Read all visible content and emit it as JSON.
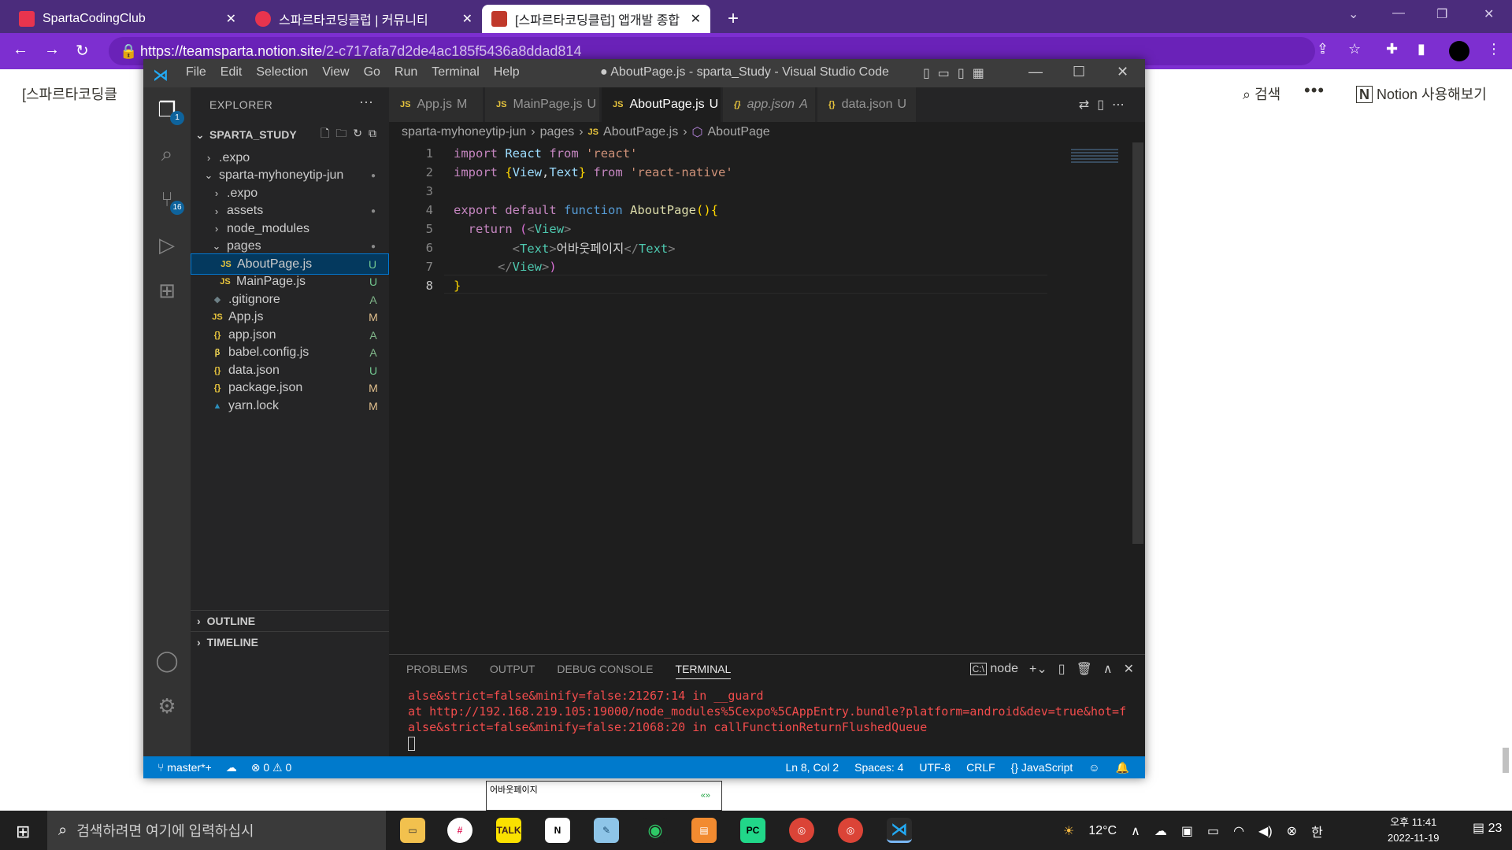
{
  "browser": {
    "tabs": [
      {
        "label": "SpartaCodingClub",
        "active": false
      },
      {
        "label": "스파르타코딩클럽 | 커뮤니티",
        "active": false
      },
      {
        "label": "[스파르타코딩클럽] 앱개발 종합",
        "active": true
      }
    ],
    "new_tab": "+",
    "url_host": "https://teamsparta.notion.site",
    "url_path": "/2-c717afa7d2de4ac185f5436a8ddad814"
  },
  "notion": {
    "breadcrumb": "[스파르타코딩클",
    "search_label": "검색",
    "more": "•••",
    "try_label": "Notion 사용해보기",
    "preview_text": "어바웃페이지",
    "preview_mark": "«»"
  },
  "vscode": {
    "menu": [
      "File",
      "Edit",
      "Selection",
      "View",
      "Go",
      "Run",
      "Terminal",
      "Help"
    ],
    "window_title": "● AboutPage.js - sparta_Study - Visual Studio Code",
    "activity_badges": {
      "explorer": "1",
      "scm": "16"
    },
    "sidebar": {
      "title": "EXPLORER",
      "more": "···",
      "project": "SPARTA_STUDY",
      "tree": [
        {
          "label": ".expo",
          "chev": "›",
          "icon": "",
          "status": ""
        },
        {
          "label": "sparta-myhoneytip-jun",
          "chev": "⌄",
          "icon": "",
          "status": "●"
        },
        {
          "label": ".expo",
          "chev": "›",
          "icon": "",
          "status": ""
        },
        {
          "label": "assets",
          "chev": "›",
          "icon": "",
          "status": "●"
        },
        {
          "label": "node_modules",
          "chev": "›",
          "icon": "",
          "status": ""
        },
        {
          "label": "pages",
          "chev": "⌄",
          "icon": "",
          "status": "●"
        },
        {
          "label": "AboutPage.js",
          "chev": "",
          "icon": "JS",
          "status": "U"
        },
        {
          "label": "MainPage.js",
          "chev": "",
          "icon": "JS",
          "status": "U"
        },
        {
          "label": ".gitignore",
          "chev": "",
          "icon": "◆",
          "status": "A"
        },
        {
          "label": "App.js",
          "chev": "",
          "icon": "JS",
          "status": "M"
        },
        {
          "label": "app.json",
          "chev": "",
          "icon": "{}",
          "status": "A"
        },
        {
          "label": "babel.config.js",
          "chev": "",
          "icon": "β",
          "status": "A"
        },
        {
          "label": "data.json",
          "chev": "",
          "icon": "{}",
          "status": "U"
        },
        {
          "label": "package.json",
          "chev": "",
          "icon": "{}",
          "status": "M"
        },
        {
          "label": "yarn.lock",
          "chev": "",
          "icon": "▲",
          "status": "M"
        }
      ],
      "outline": "OUTLINE",
      "timeline": "TIMELINE"
    },
    "tabs": [
      {
        "icon": "JS",
        "label": "App.js",
        "status": "M"
      },
      {
        "icon": "JS",
        "label": "MainPage.js",
        "status": "U"
      },
      {
        "icon": "JS",
        "label": "AboutPage.js",
        "status": "U"
      },
      {
        "icon": "{}",
        "label": "app.json",
        "status": "A"
      },
      {
        "icon": "{}",
        "label": "data.json",
        "status": "U"
      }
    ],
    "breadcrumb": [
      "sparta-myhoneytip-jun",
      "pages",
      "AboutPage.js",
      "AboutPage"
    ],
    "line_numbers": [
      "1",
      "2",
      "3",
      "4",
      "5",
      "6",
      "7",
      "8"
    ],
    "code": {
      "l1": [
        "import",
        "React",
        "from",
        "'react'"
      ],
      "l2": [
        "import",
        "{",
        "View",
        ",",
        "Text",
        "}",
        "from",
        "'react-native'"
      ],
      "l4": [
        "export",
        "default",
        "function",
        "AboutPage",
        "()",
        "{"
      ],
      "l5": [
        "return",
        "(",
        "<",
        "View",
        ">"
      ],
      "l6": [
        "<",
        "Text",
        ">",
        "어바웃페이지",
        "</",
        "Text",
        ">"
      ],
      "l7": [
        "</",
        "View",
        ">",
        ")"
      ],
      "l8": [
        "}"
      ]
    },
    "panel": {
      "tabs": [
        "PROBLEMS",
        "OUTPUT",
        "DEBUG CONSOLE",
        "TERMINAL"
      ],
      "shell": "node",
      "lines": [
        "alse&strict=false&minify=false:21267:14 in __guard",
        "at http://192.168.219.105:19000/node_modules%5Cexpo%5CAppEntry.bundle?platform=android&dev=true&hot=f",
        "alse&strict=false&minify=false:21068:20 in callFunctionReturnFlushedQueue"
      ]
    },
    "status": {
      "branch": "master*+",
      "errors": "0",
      "warnings": "0",
      "position": "Ln 8, Col 2",
      "spaces": "Spaces: 4",
      "encoding": "UTF-8",
      "eol": "CRLF",
      "language": "JavaScript"
    }
  },
  "taskbar": {
    "search_placeholder": "검색하려면 여기에 입력하십시",
    "apps": [
      "files",
      "slack",
      "kakaotalk",
      "notion",
      "notepad",
      "whale",
      "keynote",
      "pycharm",
      "chrome",
      "chrome-dev",
      "vscode"
    ],
    "temperature": "12°C",
    "ime": "한",
    "time": "오후 11:41",
    "date": "2022-11-19",
    "notifications": "23"
  }
}
